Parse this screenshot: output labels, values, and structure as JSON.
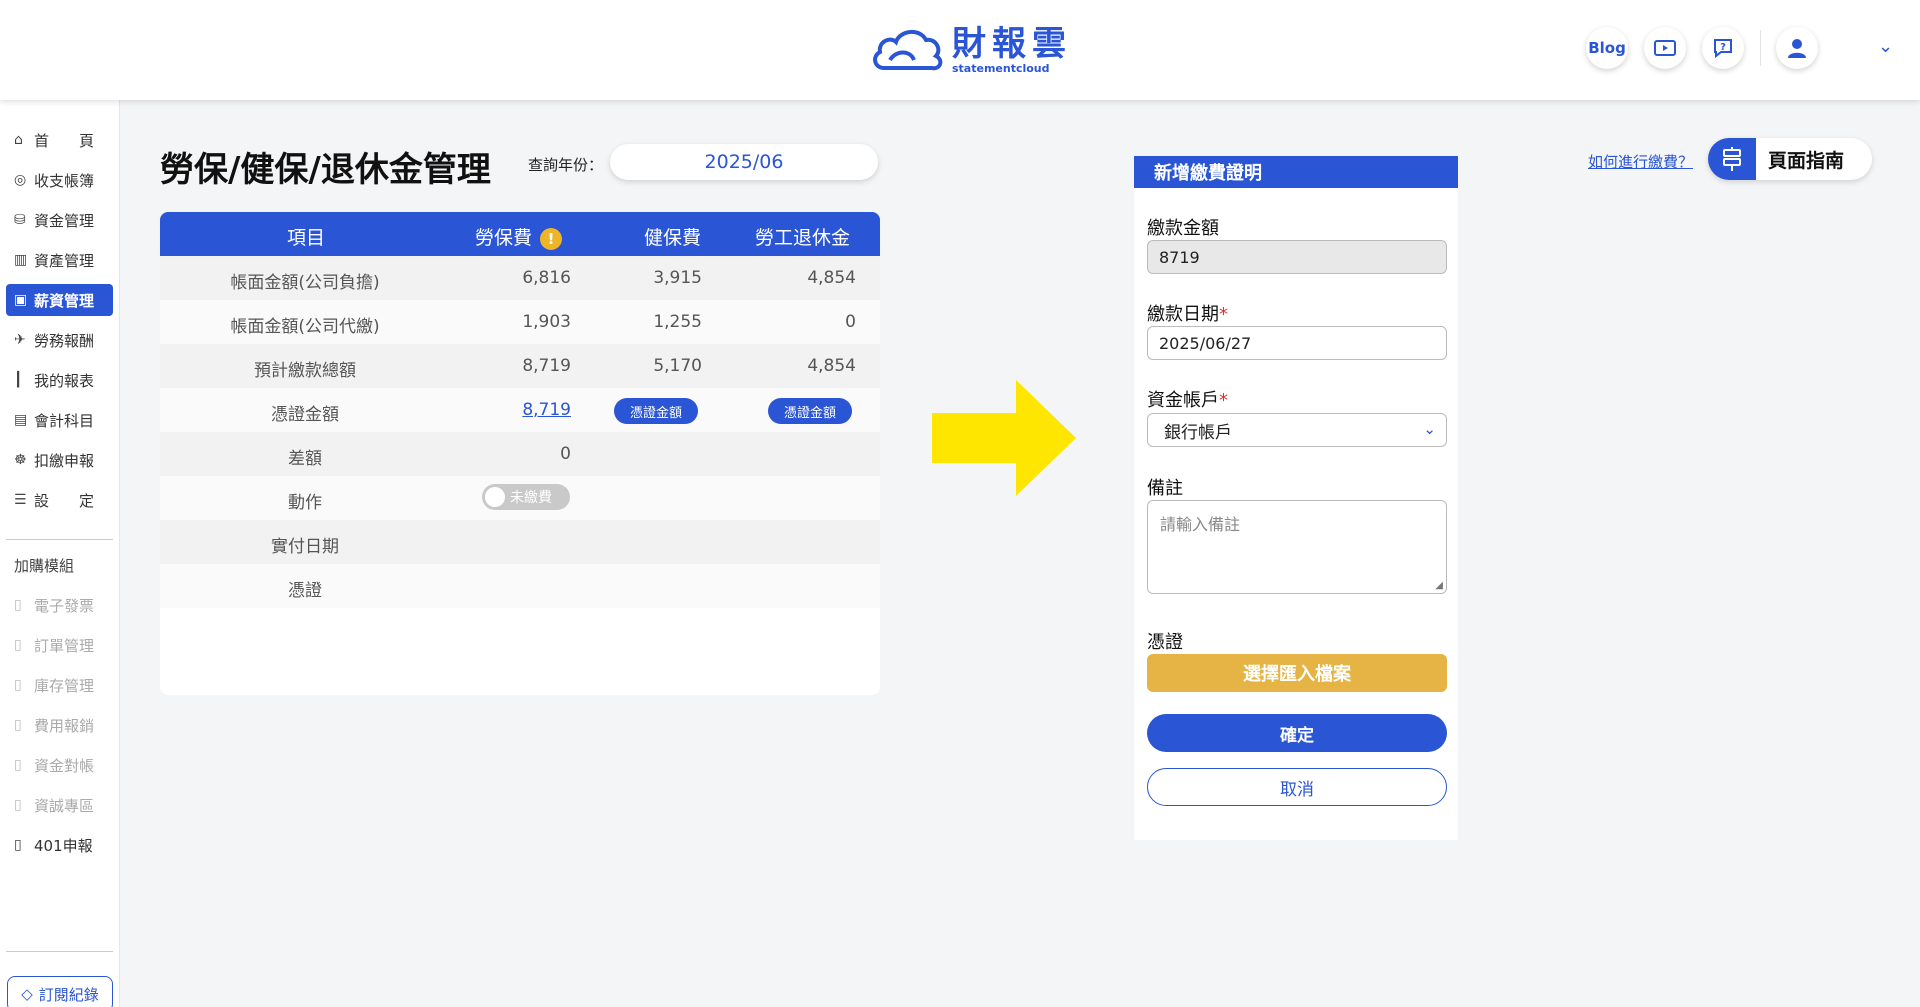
{
  "header": {
    "logo_cn": "財報雲",
    "logo_en": "statementcloud",
    "blog_label": "Blog"
  },
  "sidebar": {
    "items": [
      {
        "label": "首　　頁",
        "icon": "home-icon"
      },
      {
        "label": "收支帳簿",
        "icon": "coin-icon"
      },
      {
        "label": "資金管理",
        "icon": "fund-icon"
      },
      {
        "label": "資產管理",
        "icon": "chart-icon"
      },
      {
        "label": "薪資管理",
        "icon": "salary-icon"
      },
      {
        "label": "勞務報酬",
        "icon": "labor-icon"
      },
      {
        "label": "我的報表",
        "icon": "report-icon"
      },
      {
        "label": "會計科目",
        "icon": "ledger-icon"
      },
      {
        "label": "扣繳申報",
        "icon": "tax-icon"
      },
      {
        "label": "設　　定",
        "icon": "settings-icon"
      }
    ],
    "addon_title": "加購模組",
    "addons": [
      "電子發票",
      "訂單管理",
      "庫存管理",
      "費用報銷",
      "資金對帳",
      "資誠專區",
      "401申報"
    ],
    "subscription_label": "訂閱紀錄"
  },
  "page": {
    "title": "勞保/健保/退休金管理",
    "query_label": "查詢年份：",
    "query_value": "2025/06"
  },
  "table": {
    "headers": [
      "項目",
      "勞保費",
      "健保費",
      "勞工退休金"
    ],
    "rows": [
      {
        "label": "帳面金額(公司負擔)",
        "a": "6,816",
        "b": "3,915",
        "c": "4,854"
      },
      {
        "label": "帳面金額(公司代繳)",
        "a": "1,903",
        "b": "1,255",
        "c": "0"
      },
      {
        "label": "預計繳款總額",
        "a": "8,719",
        "b": "5,170",
        "c": "4,854"
      },
      {
        "label": "憑證金額",
        "a": "8,719",
        "b_pill": "憑證金額",
        "c_pill": "憑證金額"
      },
      {
        "label": "差額",
        "a": "0"
      },
      {
        "label": "動作",
        "toggle": "未繳費"
      },
      {
        "label": "實付日期"
      },
      {
        "label": "憑證"
      }
    ]
  },
  "form": {
    "title": "新增繳費證明",
    "amount_label": "繳款金額",
    "amount_value": "8719",
    "date_label": "繳款日期",
    "date_value": "2025/06/27",
    "account_label": "資金帳戶",
    "account_value": "銀行帳戶",
    "note_label": "備註",
    "note_placeholder": "請輸入備註",
    "voucher_label": "憑證",
    "file_button": "選擇匯入檔案",
    "confirm_button": "確定",
    "cancel_button": "取消",
    "required_mark": "*"
  },
  "guide": {
    "link": "如何進行繳費？",
    "button": "頁面指南"
  },
  "colors": {
    "primary": "#2a55d4",
    "accent_yellow": "#e5b445",
    "arrow": "#ffe600"
  }
}
